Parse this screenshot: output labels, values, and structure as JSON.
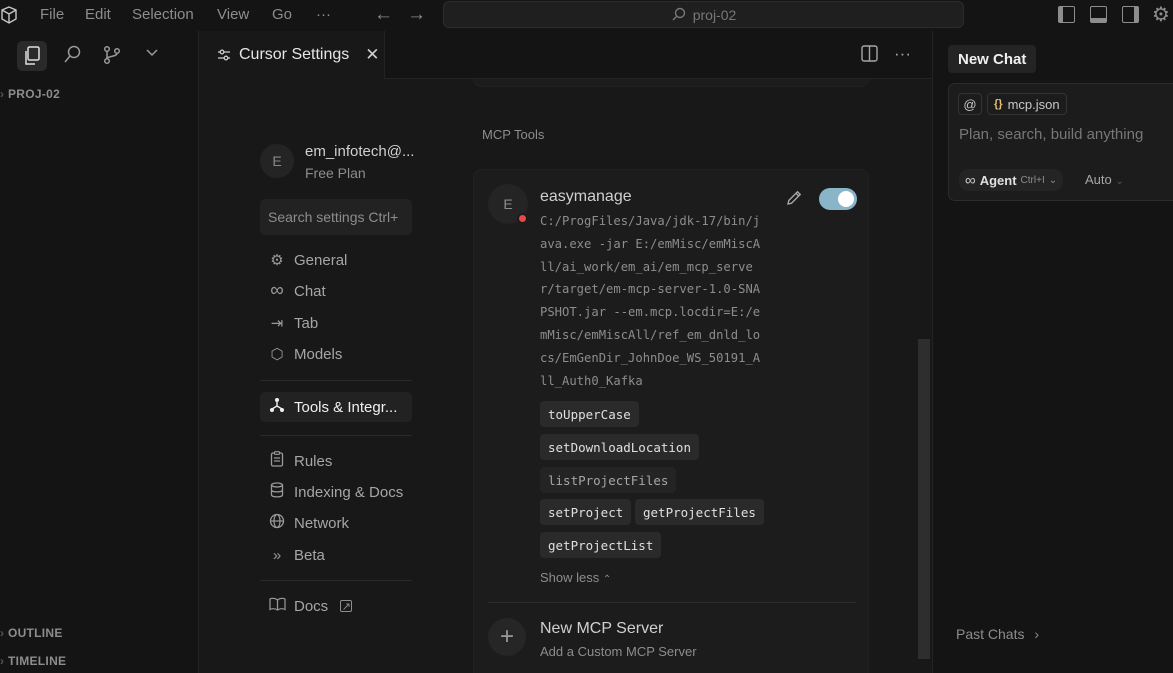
{
  "titlebar": {
    "menus": [
      "File",
      "Edit",
      "Selection",
      "View",
      "Go"
    ],
    "more": "···",
    "search_text": "proj-02"
  },
  "sidebar": {
    "project": "PROJ-02",
    "outline": "OUTLINE",
    "timeline": "TIMELINE"
  },
  "tab": {
    "title": "Cursor Settings"
  },
  "profile": {
    "avatar_letter": "E",
    "email": "em_infotech@...",
    "plan": "Free Plan"
  },
  "search": {
    "placeholder": "Search settings Ctrl+"
  },
  "nav": [
    {
      "label": "General",
      "icon": "gear-icon"
    },
    {
      "label": "Chat",
      "icon": "infinity-icon"
    },
    {
      "label": "Tab",
      "icon": "tab-arrow-icon"
    },
    {
      "label": "Models",
      "icon": "cube-icon"
    },
    {
      "label": "Tools & Integr...",
      "icon": "integrations-icon"
    },
    {
      "label": "Rules",
      "icon": "clipboard-icon"
    },
    {
      "label": "Indexing & Docs",
      "icon": "database-icon"
    },
    {
      "label": "Network",
      "icon": "globe-icon"
    },
    {
      "label": "Beta",
      "icon": "chevrons-right-icon"
    },
    {
      "label": "Docs",
      "icon": "book-icon"
    }
  ],
  "mcp": {
    "section_title": "MCP Tools",
    "server": {
      "avatar_letter": "E",
      "name": "easymanage",
      "command": "C:/ProgFiles/Java/jdk-17/bin/java.exe -jar E:/emMisc/emMiscAll/ai_work/em_ai/em_mcp_server/target/em-mcp-server-1.0-SNAPSHOT.jar --em.mcp.locdir=E:/emMisc/emMiscAll/ref_em_dnld_locs/EmGenDir_JohnDoe_WS_50191_All_Auth0_Kafka",
      "enabled": true,
      "status_color": "#e5484d"
    },
    "tools": [
      "toUpperCase",
      "setDownloadLocation",
      "listProjectFiles",
      "setProject",
      "getProjectFiles",
      "getProjectList"
    ],
    "show_less": "Show less",
    "new_server_title": "New MCP Server",
    "new_server_subtitle": "Add a Custom MCP Server"
  },
  "chat": {
    "tab_label": "New Chat",
    "context_file": "mcp.json",
    "placeholder": "Plan, search, build anything",
    "mode": "Agent",
    "mode_shortcut": "Ctrl+I",
    "model": "Auto",
    "past_chats": "Past Chats"
  }
}
